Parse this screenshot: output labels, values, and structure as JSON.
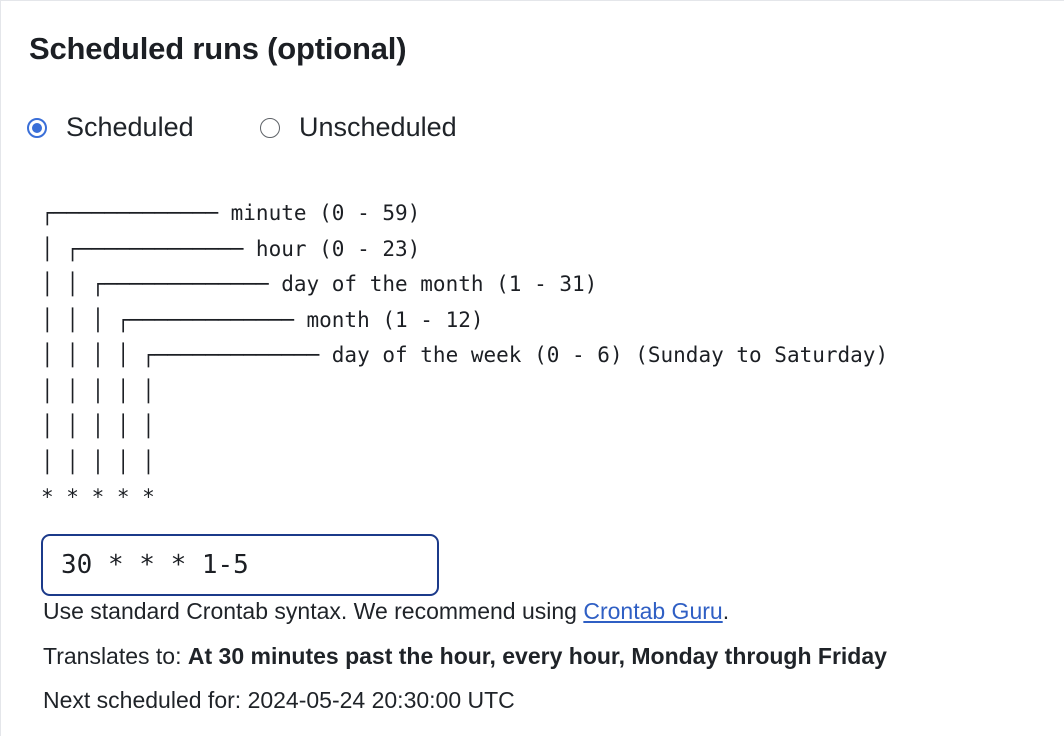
{
  "section": {
    "title": "Scheduled runs (optional)"
  },
  "schedule_mode": {
    "options": [
      {
        "label": "Scheduled",
        "selected": true
      },
      {
        "label": "Unscheduled",
        "selected": false
      }
    ],
    "accent_color": "#3a6fd8"
  },
  "cron_diagram": {
    "fields": [
      {
        "name": "minute",
        "range": "(0 - 59)"
      },
      {
        "name": "hour",
        "range": "(0 - 23)"
      },
      {
        "name": "day of the month",
        "range": "(1 - 31)"
      },
      {
        "name": "month",
        "range": "(1 - 12)"
      },
      {
        "name": "day of the week",
        "range": "(0 - 6) (Sunday to Saturday)"
      }
    ],
    "text": "┌───────────── minute (0 - 59)\n│ ┌───────────── hour (0 - 23)\n│ │ ┌───────────── day of the month (1 - 31)\n│ │ │ ┌───────────── month (1 - 12)\n│ │ │ │ ┌───────────── day of the week (0 - 6) (Sunday to Saturday)\n│ │ │ │ │\n│ │ │ │ │\n│ │ │ │ │\n* * * * *"
  },
  "cron_input": {
    "value": "30 * * * 1-5"
  },
  "hint": {
    "prefix": "Use standard Crontab syntax. We recommend using ",
    "link_text": "Crontab Guru",
    "suffix": "."
  },
  "translation": {
    "label": "Translates to: ",
    "value": "At 30 minutes past the hour, every hour, Monday through Friday"
  },
  "next_run": {
    "label": "Next scheduled for: ",
    "value": "2024-05-24 20:30:00 UTC"
  }
}
